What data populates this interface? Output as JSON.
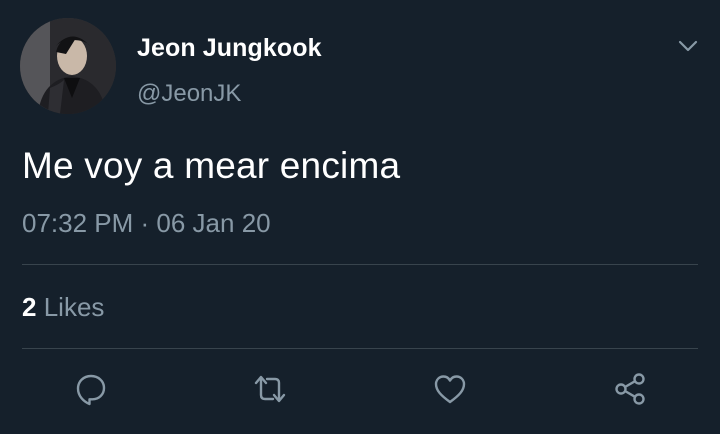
{
  "tweet": {
    "author": {
      "display_name": "Jeon Jungkook",
      "handle": "@JeonJK"
    },
    "text": "Me voy a mear encima",
    "time": "07:32 PM",
    "separator": " · ",
    "date": "06 Jan 20",
    "likes": {
      "count": "2",
      "label": "Likes"
    }
  },
  "actions": [
    {
      "icon": "reply-icon"
    },
    {
      "icon": "retweet-icon"
    },
    {
      "icon": "like-heart-icon"
    },
    {
      "icon": "share-icon"
    }
  ],
  "colors": {
    "background": "#15202b",
    "primary_text": "#ffffff",
    "secondary_text": "#8899a6",
    "divider": "#38444d"
  }
}
